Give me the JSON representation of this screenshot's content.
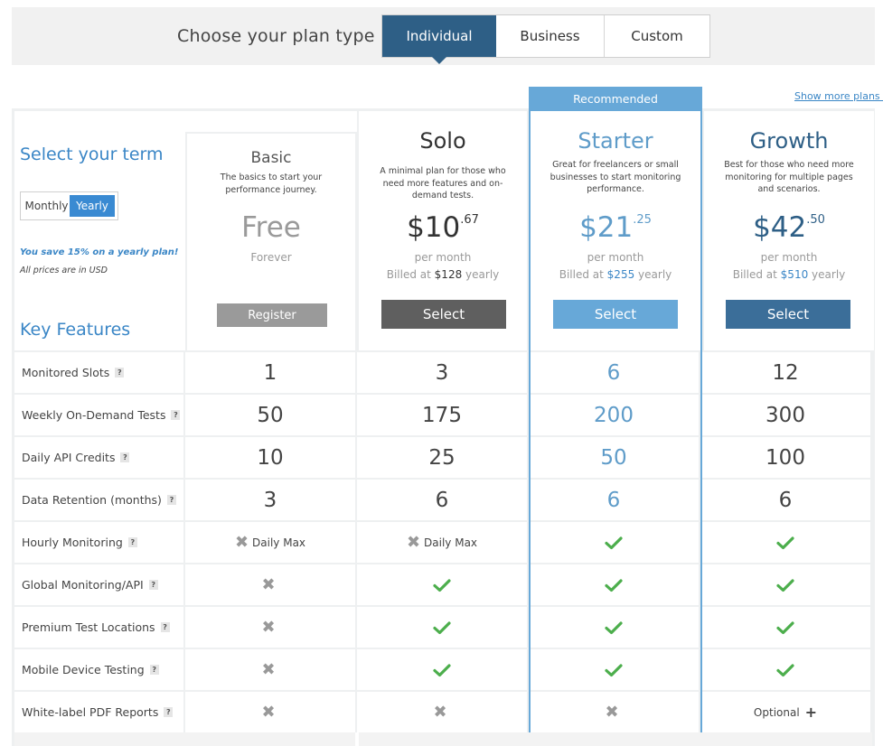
{
  "plan_type": {
    "label": "Choose your plan type",
    "options": [
      "Individual",
      "Business",
      "Custom"
    ],
    "selected": "Individual"
  },
  "recommended_label": "Recommended",
  "show_more": "Show more plans ›",
  "term": {
    "title": "Select your term",
    "options": [
      "Monthly",
      "Yearly"
    ],
    "selected": "Yearly",
    "save_note": "You save 15% on a yearly plan!",
    "currency_note": "All prices are in USD"
  },
  "key_features_title": "Key Features",
  "plans": {
    "basic": {
      "name": "Basic",
      "desc": "The basics to start your performance journey.",
      "price": "Free",
      "period": "Forever",
      "button": "Register"
    },
    "solo": {
      "name": "Solo",
      "desc": "A minimal plan for those who need more features and on-demand tests.",
      "price_whole": "$10",
      "price_cents": ".67",
      "per": "per month",
      "billed_prefix": "Billed at",
      "billed_amount": "$128",
      "billed_suffix": "yearly",
      "button": "Select"
    },
    "starter": {
      "name": "Starter",
      "desc": "Great for freelancers or small businesses to start monitoring performance.",
      "price_whole": "$21",
      "price_cents": ".25",
      "per": "per month",
      "billed_prefix": "Billed at",
      "billed_amount": "$255",
      "billed_suffix": "yearly",
      "button": "Select"
    },
    "growth": {
      "name": "Growth",
      "desc": "Best for those who need more monitoring for multiple pages and scenarios.",
      "price_whole": "$42",
      "price_cents": ".50",
      "per": "per month",
      "billed_prefix": "Billed at",
      "billed_amount": "$510",
      "billed_suffix": "yearly",
      "button": "Select"
    }
  },
  "features": [
    {
      "label": "Monitored Slots",
      "values": [
        "1",
        "3",
        "6",
        "12"
      ]
    },
    {
      "label": "Weekly On-Demand Tests",
      "values": [
        "50",
        "175",
        "200",
        "300"
      ]
    },
    {
      "label": "Daily API Credits",
      "values": [
        "10",
        "25",
        "50",
        "100"
      ]
    },
    {
      "label": "Data Retention (months)",
      "values": [
        "3",
        "6",
        "6",
        "6"
      ]
    },
    {
      "label": "Hourly Monitoring",
      "values": [
        "x:Daily Max",
        "x:Daily Max",
        "check",
        "check"
      ]
    },
    {
      "label": "Global Monitoring/API",
      "values": [
        "x",
        "check",
        "check",
        "check"
      ]
    },
    {
      "label": "Premium Test Locations",
      "values": [
        "x",
        "check",
        "check",
        "check"
      ]
    },
    {
      "label": "Mobile Device Testing",
      "values": [
        "x",
        "check",
        "check",
        "check"
      ]
    },
    {
      "label": "White-label PDF Reports",
      "values": [
        "x",
        "x",
        "x",
        "plus:Optional"
      ]
    }
  ],
  "help_glyph": "?",
  "colors": {
    "individual_active": "#2e5f86",
    "recommended": "#67a8d8",
    "check": "#4cae4c",
    "accent_text": "#3a86c6"
  }
}
